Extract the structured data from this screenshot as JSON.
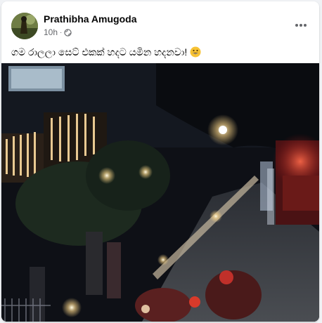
{
  "post": {
    "author": "Prathibha Amugoda",
    "time": "10h",
    "audience_icon": "globe-icon",
    "caption": "ගම රාලලා සෙට් එකක් හදට යමින හදනවා!",
    "caption_emoji": "grinning-face-emoji",
    "more_icon": "ellipsis-icon"
  },
  "colors": {
    "name": "#050505",
    "meta": "#65676b",
    "card": "#ffffff",
    "page": "#f0f2f5"
  }
}
